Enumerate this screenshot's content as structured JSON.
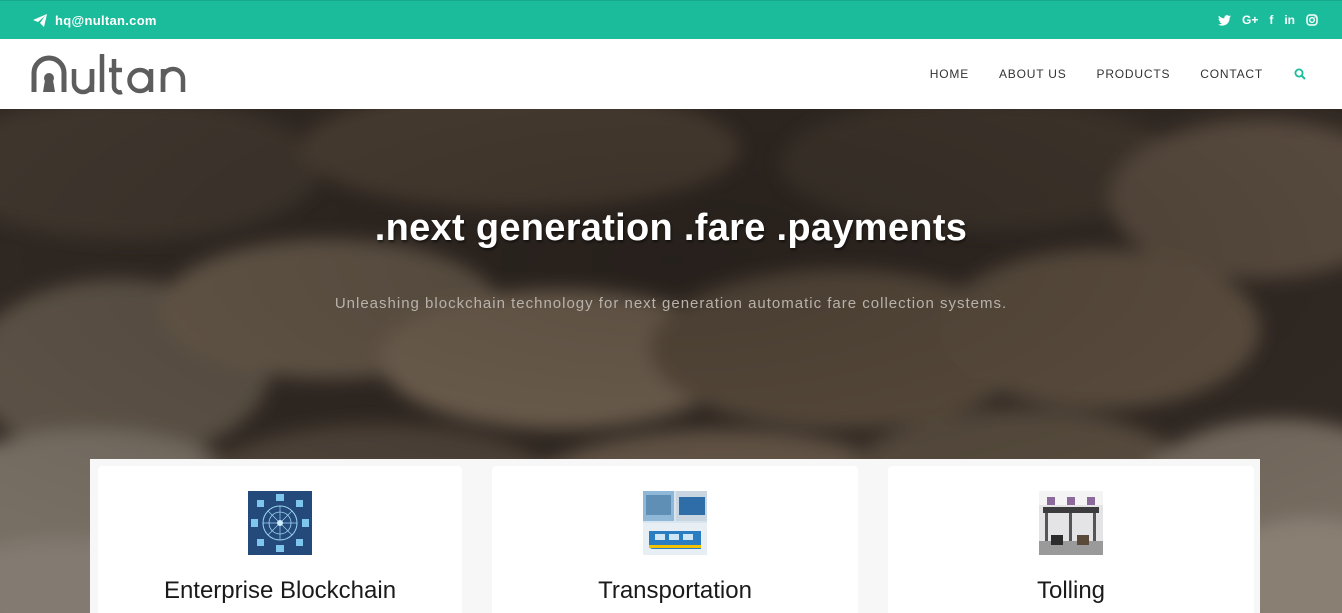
{
  "topbar": {
    "email": "hq@nultan.com",
    "social": [
      "twitter-icon",
      "google-plus-icon",
      "facebook-icon",
      "linkedin-icon",
      "instagram-icon"
    ],
    "googleplus_label": "G+",
    "facebook_label": "f",
    "linkedin_label": "in",
    "color": "#1abc9c"
  },
  "header": {
    "logo_text": "nultan",
    "nav": [
      "HOME",
      "ABOUT US",
      "PRODUCTS",
      "CONTACT"
    ],
    "search_icon": "search-icon",
    "accent": "#1abc9c"
  },
  "hero": {
    "title": ".next generation .fare .payments",
    "subtitle": "Unleashing blockchain technology for next generation automatic fare collection systems."
  },
  "cards": [
    {
      "title": "Enterprise Blockchain",
      "icon": "blockchain-network-image"
    },
    {
      "title": "Transportation",
      "icon": "train-image"
    },
    {
      "title": "Tolling",
      "icon": "toll-booth-image"
    }
  ]
}
